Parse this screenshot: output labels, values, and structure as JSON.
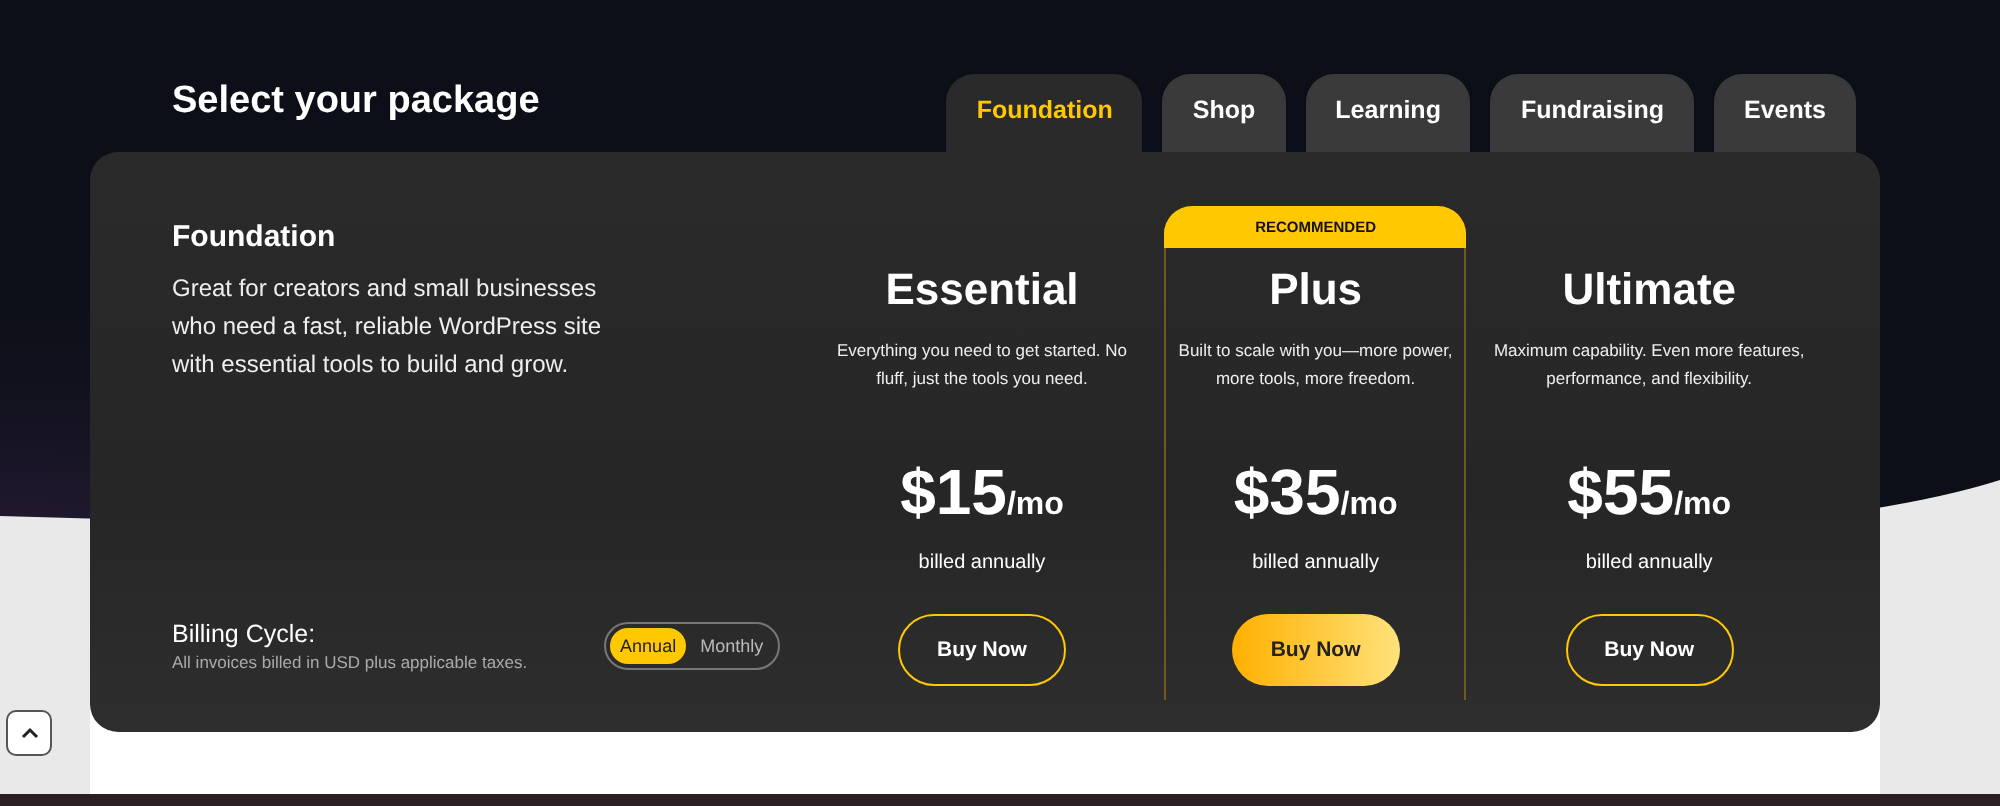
{
  "heading": "Select your package",
  "tabs": [
    {
      "label": "Foundation",
      "selected": true
    },
    {
      "label": "Shop",
      "selected": false
    },
    {
      "label": "Learning",
      "selected": false
    },
    {
      "label": "Fundraising",
      "selected": false
    },
    {
      "label": "Events",
      "selected": false
    }
  ],
  "package": {
    "title": "Foundation",
    "description": "Great for creators and small businesses who need a fast, reliable WordPress site with essential tools to build and grow."
  },
  "billing": {
    "label": "Billing Cycle:",
    "note": "All invoices billed in USD plus applicable taxes.",
    "options": [
      {
        "label": "Annual",
        "selected": true
      },
      {
        "label": "Monthly",
        "selected": false
      }
    ]
  },
  "plans": [
    {
      "name": "Essential",
      "featured": false,
      "description": "Everything you need to get started. No fluff, just the tools you need.",
      "price": "$15",
      "period": "/mo",
      "billing": "billed annually",
      "button": "Buy Now"
    },
    {
      "name": "Plus",
      "badge": "RECOMMENDED",
      "featured": true,
      "description": "Built to scale with you—more power, more tools, more freedom.",
      "price": "$35",
      "period": "/mo",
      "billing": "billed annually",
      "button": "Buy Now"
    },
    {
      "name": "Ultimate",
      "featured": false,
      "description": "Maximum capability. Even more features, performance, and flexibility.",
      "price": "$55",
      "period": "/mo",
      "billing": "billed annually",
      "button": "Buy Now"
    }
  ]
}
